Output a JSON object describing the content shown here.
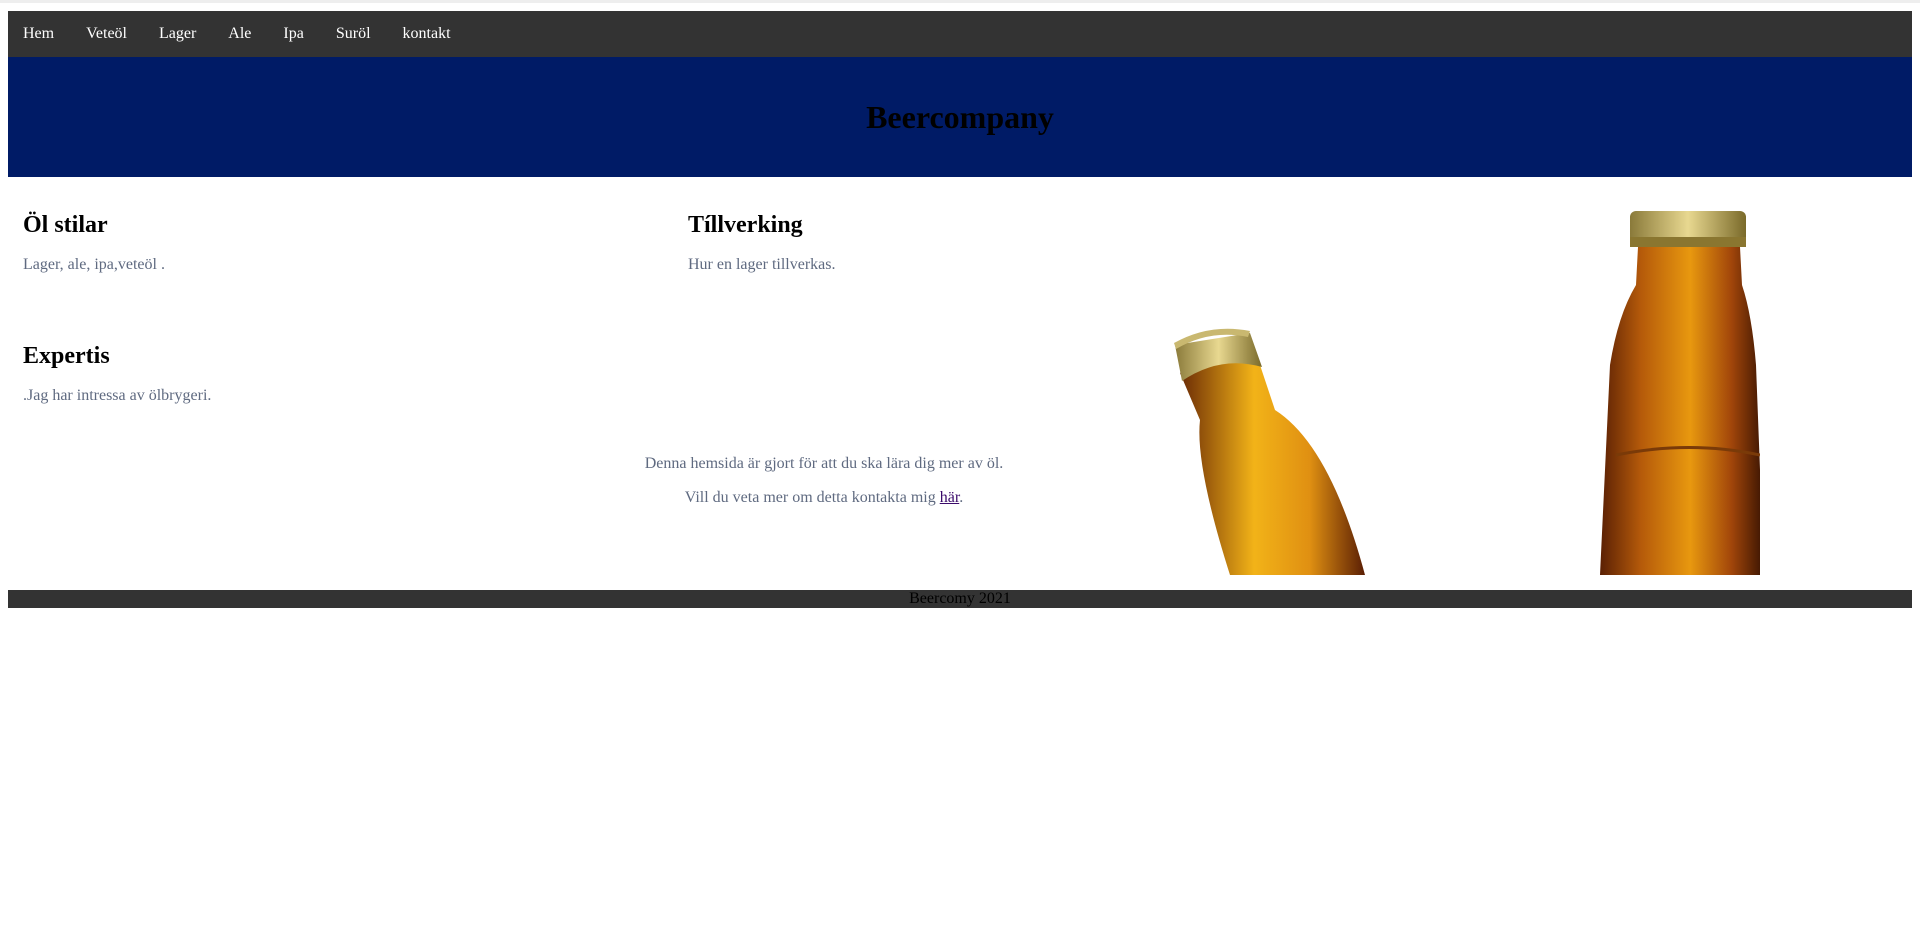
{
  "nav": {
    "items": [
      {
        "label": "Hem"
      },
      {
        "label": "Veteöl"
      },
      {
        "label": "Lager"
      },
      {
        "label": "Ale"
      },
      {
        "label": "Ipa"
      },
      {
        "label": "Suröl"
      },
      {
        "label": "kontakt"
      }
    ]
  },
  "header": {
    "title": "Beercompany"
  },
  "sections": {
    "styles": {
      "heading": "Öl stilar",
      "text": "Lager, ale, ipa,veteöl ."
    },
    "production": {
      "heading": "Tíllverking",
      "text": "Hur en lager tillverkas."
    },
    "expertise": {
      "heading": "Expertis",
      "text": ".Jag har intressa av ölbrygeri."
    }
  },
  "info": {
    "line1": "Denna hemsida är gjort för att du ska lära dig mer av öl.",
    "line2_prefix": "Vill du veta mer om detta kontakta mig ",
    "line2_link": "här",
    "line2_suffix": "."
  },
  "footer": {
    "text": "Beercomy 2021"
  },
  "colors": {
    "nav_bg": "#333333",
    "header_bg": "#001b66",
    "body_text": "#5f6a80"
  },
  "image": {
    "name": "beer-bottles-image"
  }
}
